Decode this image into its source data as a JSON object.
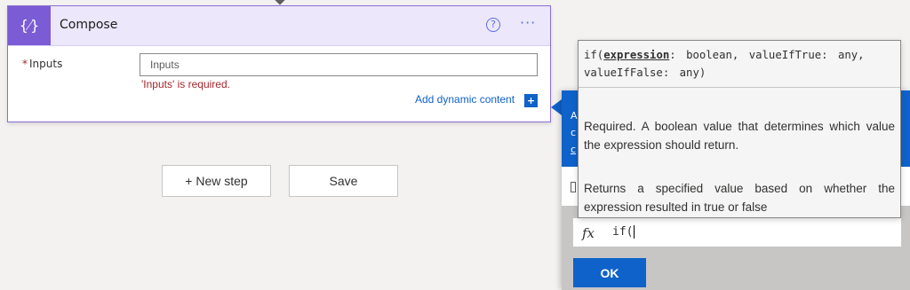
{
  "compose": {
    "title": "Compose",
    "icon_glyph": "{⁄}",
    "help_glyph": "?",
    "more_glyph": "···",
    "inputs_label": "Inputs",
    "required_mark": "*",
    "inputs_placeholder": "Inputs",
    "error": "'Inputs' is required.",
    "dynamic_content_link": "Add dynamic content",
    "dynamic_plus_glyph": "+"
  },
  "steps": {
    "new_step": "+ New step",
    "save": "Save"
  },
  "tooltip": {
    "func": "if(",
    "param": "expression",
    "sig_rest": ": boolean, valueIfTrue: any, valueIfFalse: any)",
    "param_desc": "Required. A boolean value that determines which value the expression should return.",
    "func_desc": "Returns a specified value based on whether the expression resulted in true or false"
  },
  "expression_editor": {
    "fx_label": "fx",
    "value": "if("
  },
  "panel": {
    "banner_edge_chars": [
      "A",
      "c",
      "c"
    ],
    "ok_label": "OK"
  },
  "colors": {
    "accent": "#7c5cd5",
    "link": "#0f62c9",
    "error": "#a4262c"
  }
}
